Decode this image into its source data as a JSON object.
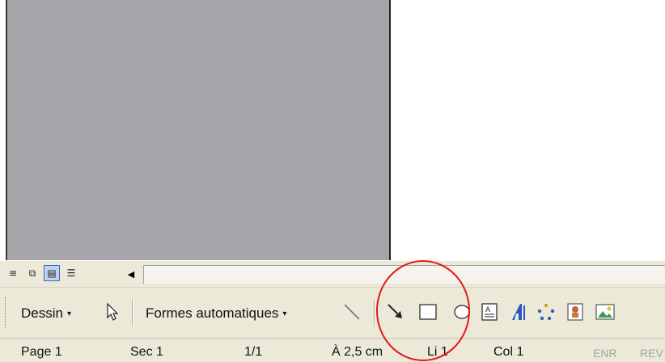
{
  "view_buttons": [
    {
      "icon": "normal-view-icon",
      "glyph": "≡"
    },
    {
      "icon": "web-layout-icon",
      "glyph": "⧉"
    },
    {
      "icon": "print-layout-icon",
      "glyph": "▤"
    },
    {
      "icon": "outline-view-icon",
      "glyph": "☰"
    }
  ],
  "scroll_left_glyph": "◀",
  "drawing_toolbar": {
    "draw_menu_label": "Dessin",
    "autoshapes_label": "Formes automatiques",
    "dropdown_glyph": "▾"
  },
  "status_bar": {
    "page": "Page 1",
    "section": "Sec 1",
    "pages": "1/1",
    "position": "À 2,5 cm",
    "line": "Li 1",
    "column": "Col 1",
    "rec": "ENR",
    "rev": "REV"
  },
  "colors": {
    "annotation_circle": "#e21a1a",
    "toolbar_bg": "#ece9d8",
    "gray_area": "#a6a5aa"
  }
}
